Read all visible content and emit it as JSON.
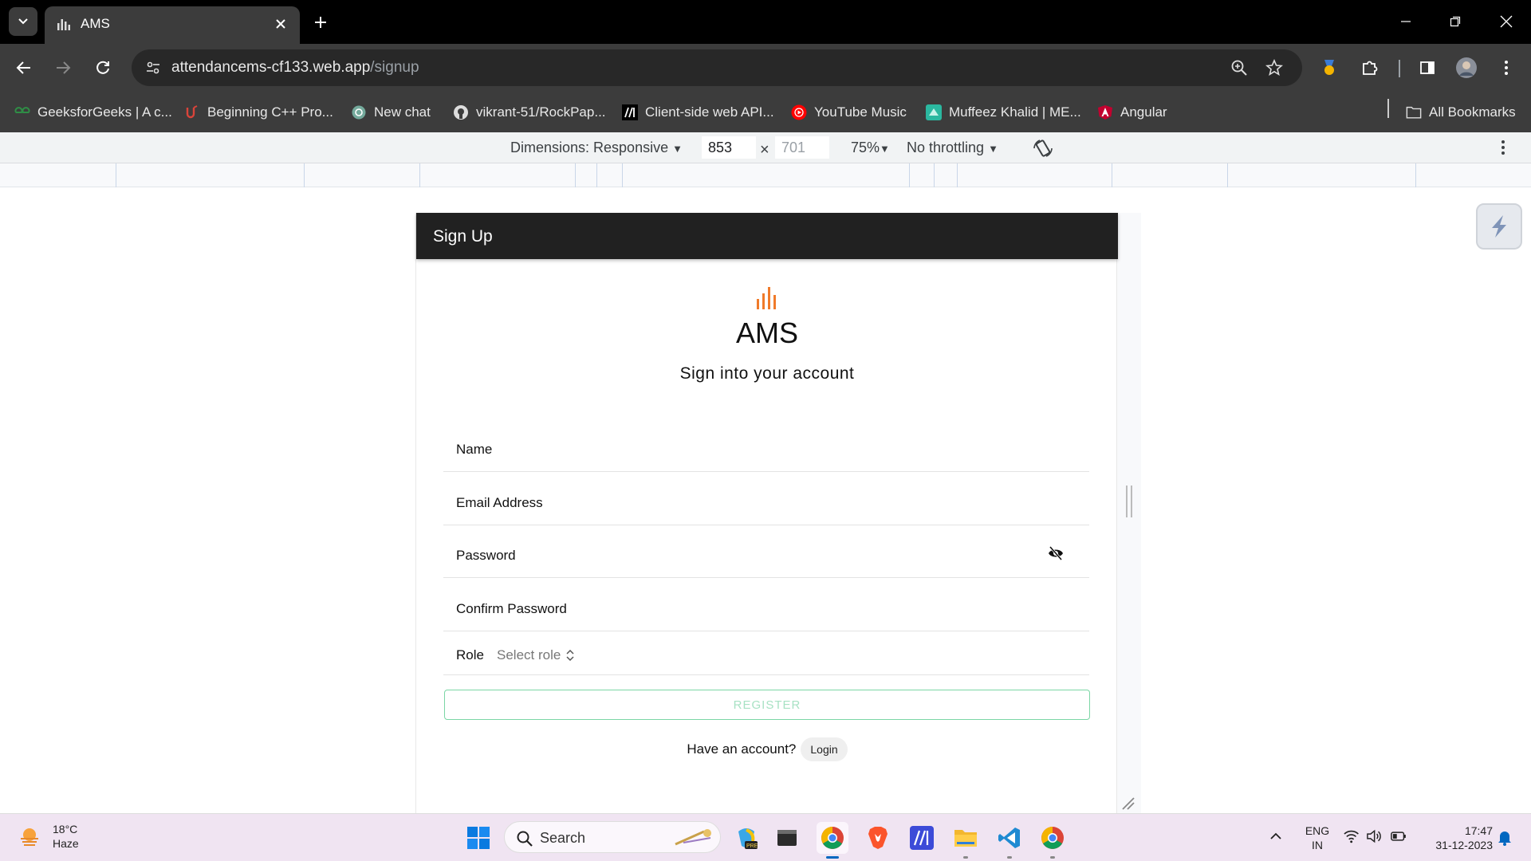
{
  "browser": {
    "tab_title": "AMS",
    "url_domain": "attendancems-cf133.web.app",
    "url_path": "/signup",
    "bookmarks": [
      {
        "label": "GeeksforGeeks | A c...",
        "icon": "geeksforgeeks-icon"
      },
      {
        "label": "Beginning C++ Pro...",
        "icon": "udemy-icon"
      },
      {
        "label": "New chat",
        "icon": "chatgpt-icon"
      },
      {
        "label": "vikrant-51/RockPap...",
        "icon": "github-icon"
      },
      {
        "label": "Client-side web API...",
        "icon": "mdn-icon"
      },
      {
        "label": "YouTube Music",
        "icon": "youtube-music-icon"
      },
      {
        "label": "Muffeez Khalid | ME...",
        "icon": "portfolio-icon"
      },
      {
        "label": "Angular",
        "icon": "angular-icon"
      }
    ],
    "all_bookmarks": "All Bookmarks"
  },
  "devtools": {
    "dimensions": "Dimensions: Responsive",
    "width": "853",
    "height": "701",
    "zoom": "75%",
    "throttling": "No throttling"
  },
  "app": {
    "header_title": "Sign Up",
    "brand": "AMS",
    "subtitle": "Sign into your account",
    "fields": {
      "name": "Name",
      "email": "Email Address",
      "password": "Password",
      "confirm_password": "Confirm Password"
    },
    "role_label": "Role",
    "role_placeholder": "Select role",
    "register": "REGISTER",
    "have_account": "Have an account?",
    "login": "Login",
    "accent_color": "#f07a2a",
    "register_color": "#7bd6a5"
  },
  "taskbar": {
    "temperature": "18°C",
    "weather": "Haze",
    "search": "Search",
    "lang": "ENG",
    "region": "IN",
    "time": "17:47",
    "date": "31-12-2023"
  }
}
